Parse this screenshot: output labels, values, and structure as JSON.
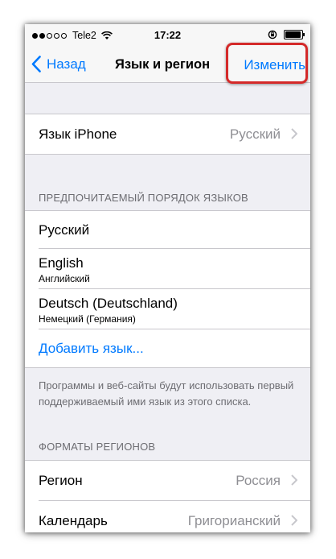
{
  "status_bar": {
    "carrier": "Tele2",
    "time": "17:22"
  },
  "nav": {
    "back_label": "Назад",
    "title": "Язык и регион",
    "edit_label": "Изменить"
  },
  "iphone_language": {
    "label": "Язык iPhone",
    "value": "Русский"
  },
  "preferred_section": {
    "header": "ПРЕДПОЧИТАЕМЫЙ ПОРЯДОК ЯЗЫКОВ",
    "languages": [
      {
        "name": "Русский",
        "subtitle": ""
      },
      {
        "name": "English",
        "subtitle": "Английский"
      },
      {
        "name": "Deutsch (Deutschland)",
        "subtitle": "Немецкий (Германия)"
      }
    ],
    "add_label": "Добавить язык...",
    "footer": "Программы и веб-сайты будут использовать первый поддерживаемый ими язык из этого списка."
  },
  "region_section": {
    "header": "ФОРМАТЫ РЕГИОНОВ",
    "region_label": "Регион",
    "region_value": "Россия",
    "calendar_label": "Календарь",
    "calendar_value": "Григорианский"
  },
  "colors": {
    "accent": "#007aff",
    "highlight": "#d42a2a"
  }
}
